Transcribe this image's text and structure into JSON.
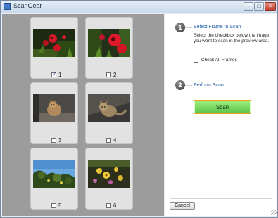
{
  "window": {
    "title": "ScanGear"
  },
  "titlebar": {
    "minimize_glyph": "–",
    "maximize_glyph": "□",
    "close_glyph": "×"
  },
  "frames": [
    {
      "number": "1",
      "checked": true,
      "icon": "red-flowers-photo"
    },
    {
      "number": "2",
      "checked": false,
      "icon": "red-flowers-photo"
    },
    {
      "number": "3",
      "checked": false,
      "icon": "cat-on-porch-photo"
    },
    {
      "number": "4",
      "checked": false,
      "icon": "cat-on-porch-photo"
    },
    {
      "number": "5",
      "checked": false,
      "icon": "tree-sky-photo"
    },
    {
      "number": "6",
      "checked": false,
      "icon": "yellow-flowers-photo"
    }
  ],
  "steps": [
    {
      "number": "1",
      "title": "Select Frame to Scan"
    },
    {
      "number": "2",
      "title": "Perform Scan"
    }
  ],
  "instructions": "Select the checkbox below the image you want to scan in the preview area.",
  "check_all_label": "Check All Frames",
  "scan_button": "Scan",
  "cancel_button": "Cancel",
  "colors": {
    "accent": "#1f5aa8",
    "scan_green": "#6fd45a",
    "scan_border": "#f0a020",
    "preview_bg": "#9c9c9c"
  }
}
